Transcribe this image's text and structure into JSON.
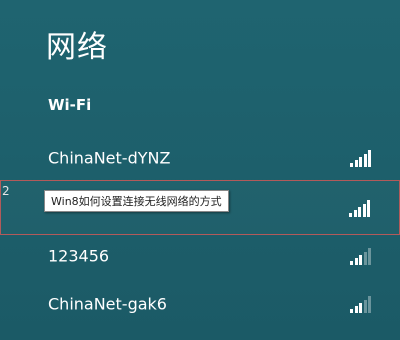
{
  "panel": {
    "title": "网络",
    "section_label": "Wi-Fi"
  },
  "networks": [
    {
      "name": "ChinaNet-dYNZ",
      "signal_bars": 5
    },
    {
      "name": "",
      "signal_bars": 5,
      "selected": true
    },
    {
      "name": "123456",
      "signal_bars": 3
    },
    {
      "name": "ChinaNet-gak6",
      "signal_bars": 3
    }
  ],
  "tooltip": {
    "text": "Win8如何设置连接无线网络的方式"
  },
  "side_mark": "2",
  "colors": {
    "background": "#1e5f6b",
    "text": "#ffffff",
    "selection_border": "#b35a5a"
  }
}
